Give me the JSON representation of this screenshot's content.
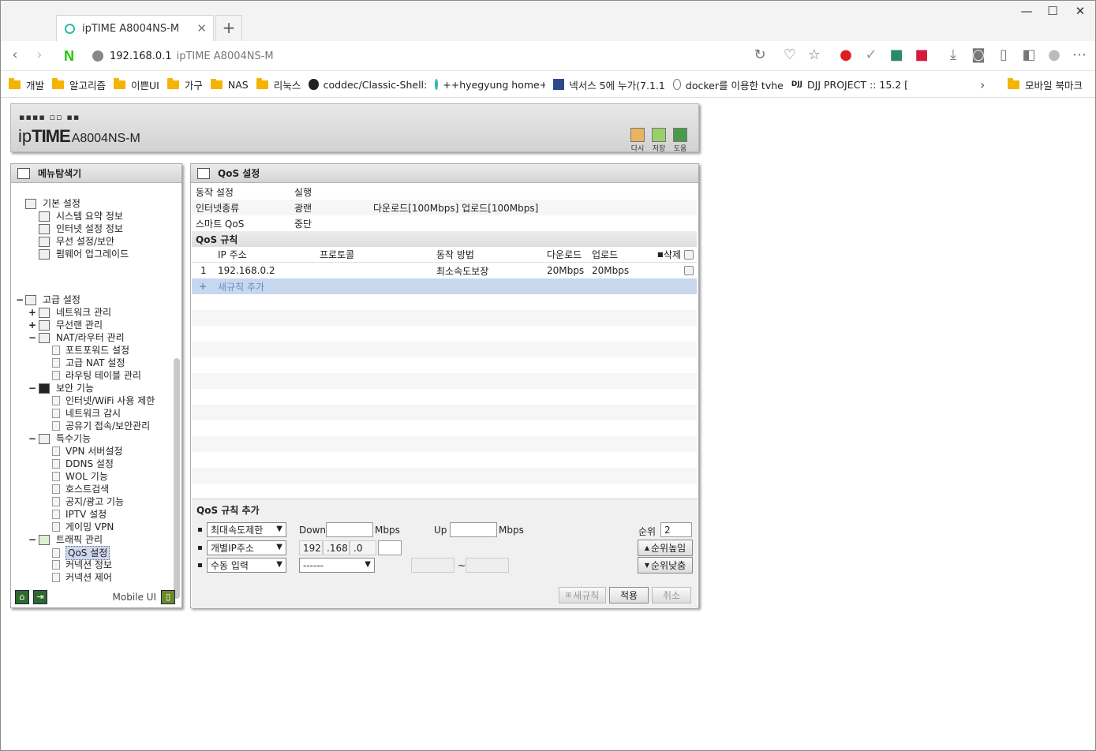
{
  "browser": {
    "tab_title": "ipTIME A8004NS-M",
    "new_tab": "+",
    "address_host": "192.168.0.1",
    "address_title": "ipTIME A8004NS-M",
    "bookmarks": [
      "개발",
      "알고리즘",
      "이쁜UI",
      "가구",
      "NAS",
      "리눅스",
      "coddec/Classic-Shell:",
      "++hyegyung home++",
      "넥서스 5에 누가(7.1.1",
      "docker를 이용한 tvhe",
      "DJJ PROJECT :: 15.2 ["
    ],
    "bookmark_right": "모바일 북마크"
  },
  "router": {
    "logo_ip": "ip",
    "logo_time": "TIME",
    "model": "A8004NS-M",
    "buttons": [
      "다시",
      "저장",
      "도움"
    ]
  },
  "nav": {
    "title": "메뉴탐색기",
    "basic": {
      "label": "기본 설정",
      "items": [
        "시스템 요약 정보",
        "인터넷 설정 정보",
        "무선 설정/보안",
        "펌웨어 업그레이드"
      ]
    },
    "advanced": {
      "label": "고급 설정",
      "network": "네트워크 관리",
      "wireless": "무선랜 관리",
      "nat": {
        "label": "NAT/라우터 관리",
        "items": [
          "포트포워드 설정",
          "고급 NAT 설정",
          "라우팅 테이블 관리"
        ]
      },
      "security": {
        "label": "보안 기능",
        "items": [
          "인터넷/WiFi 사용 제한",
          "네트워크 감시",
          "공유기 접속/보안관리"
        ]
      },
      "special": {
        "label": "특수기능",
        "items": [
          "VPN 서버설정",
          "DDNS 설정",
          "WOL 기능",
          "호스트검색",
          "공지/광고 기능",
          "IPTV 설정",
          "게이밍 VPN"
        ]
      },
      "traffic": {
        "label": "트래픽 관리",
        "items": [
          "QoS 설정",
          "커넥션 정보",
          "커넥션 제어"
        ]
      }
    },
    "mobile_ui": "Mobile UI"
  },
  "qos": {
    "title": "QoS 설정",
    "rows": [
      {
        "label": "동작 설정",
        "value": "실행",
        "extra": ""
      },
      {
        "label": "인터넷종류",
        "value": "광랜",
        "extra": "다운로드[100Mbps] 업로드[100Mbps]"
      },
      {
        "label": "스마트 QoS",
        "value": "중단",
        "extra": ""
      }
    ],
    "rules_title": "QoS 규칙",
    "columns": {
      "ip": "IP 주소",
      "protocol": "프로토콜",
      "method": "동작 방법",
      "down": "다운로드",
      "up": "업로드",
      "delete": "삭제"
    },
    "rules": [
      {
        "no": "1",
        "ip": "192.168.0.2",
        "protocol": "",
        "method": "최소속도보장",
        "down": "20Mbps",
        "up": "20Mbps"
      }
    ],
    "add_new_rule": "새규칙 추가",
    "add_panel": {
      "title": "QoS 규칙 추가",
      "mode_select": "최대속도제한",
      "down_label": "Down",
      "down_value": "",
      "mbps": "Mbps",
      "up_label": "Up",
      "up_value": "",
      "rank_label": "순위",
      "rank_value": "2",
      "ip_select": "개별IP주소",
      "ip": [
        "192",
        ".168",
        ".0",
        ""
      ],
      "rank_up": "순위높임",
      "proto_select": "수동 입력",
      "proto_select2": "------",
      "tilde": "~",
      "rank_down": "순위낮춤",
      "btn_new": "새규칙",
      "btn_apply": "적용",
      "btn_cancel": "취소"
    }
  }
}
